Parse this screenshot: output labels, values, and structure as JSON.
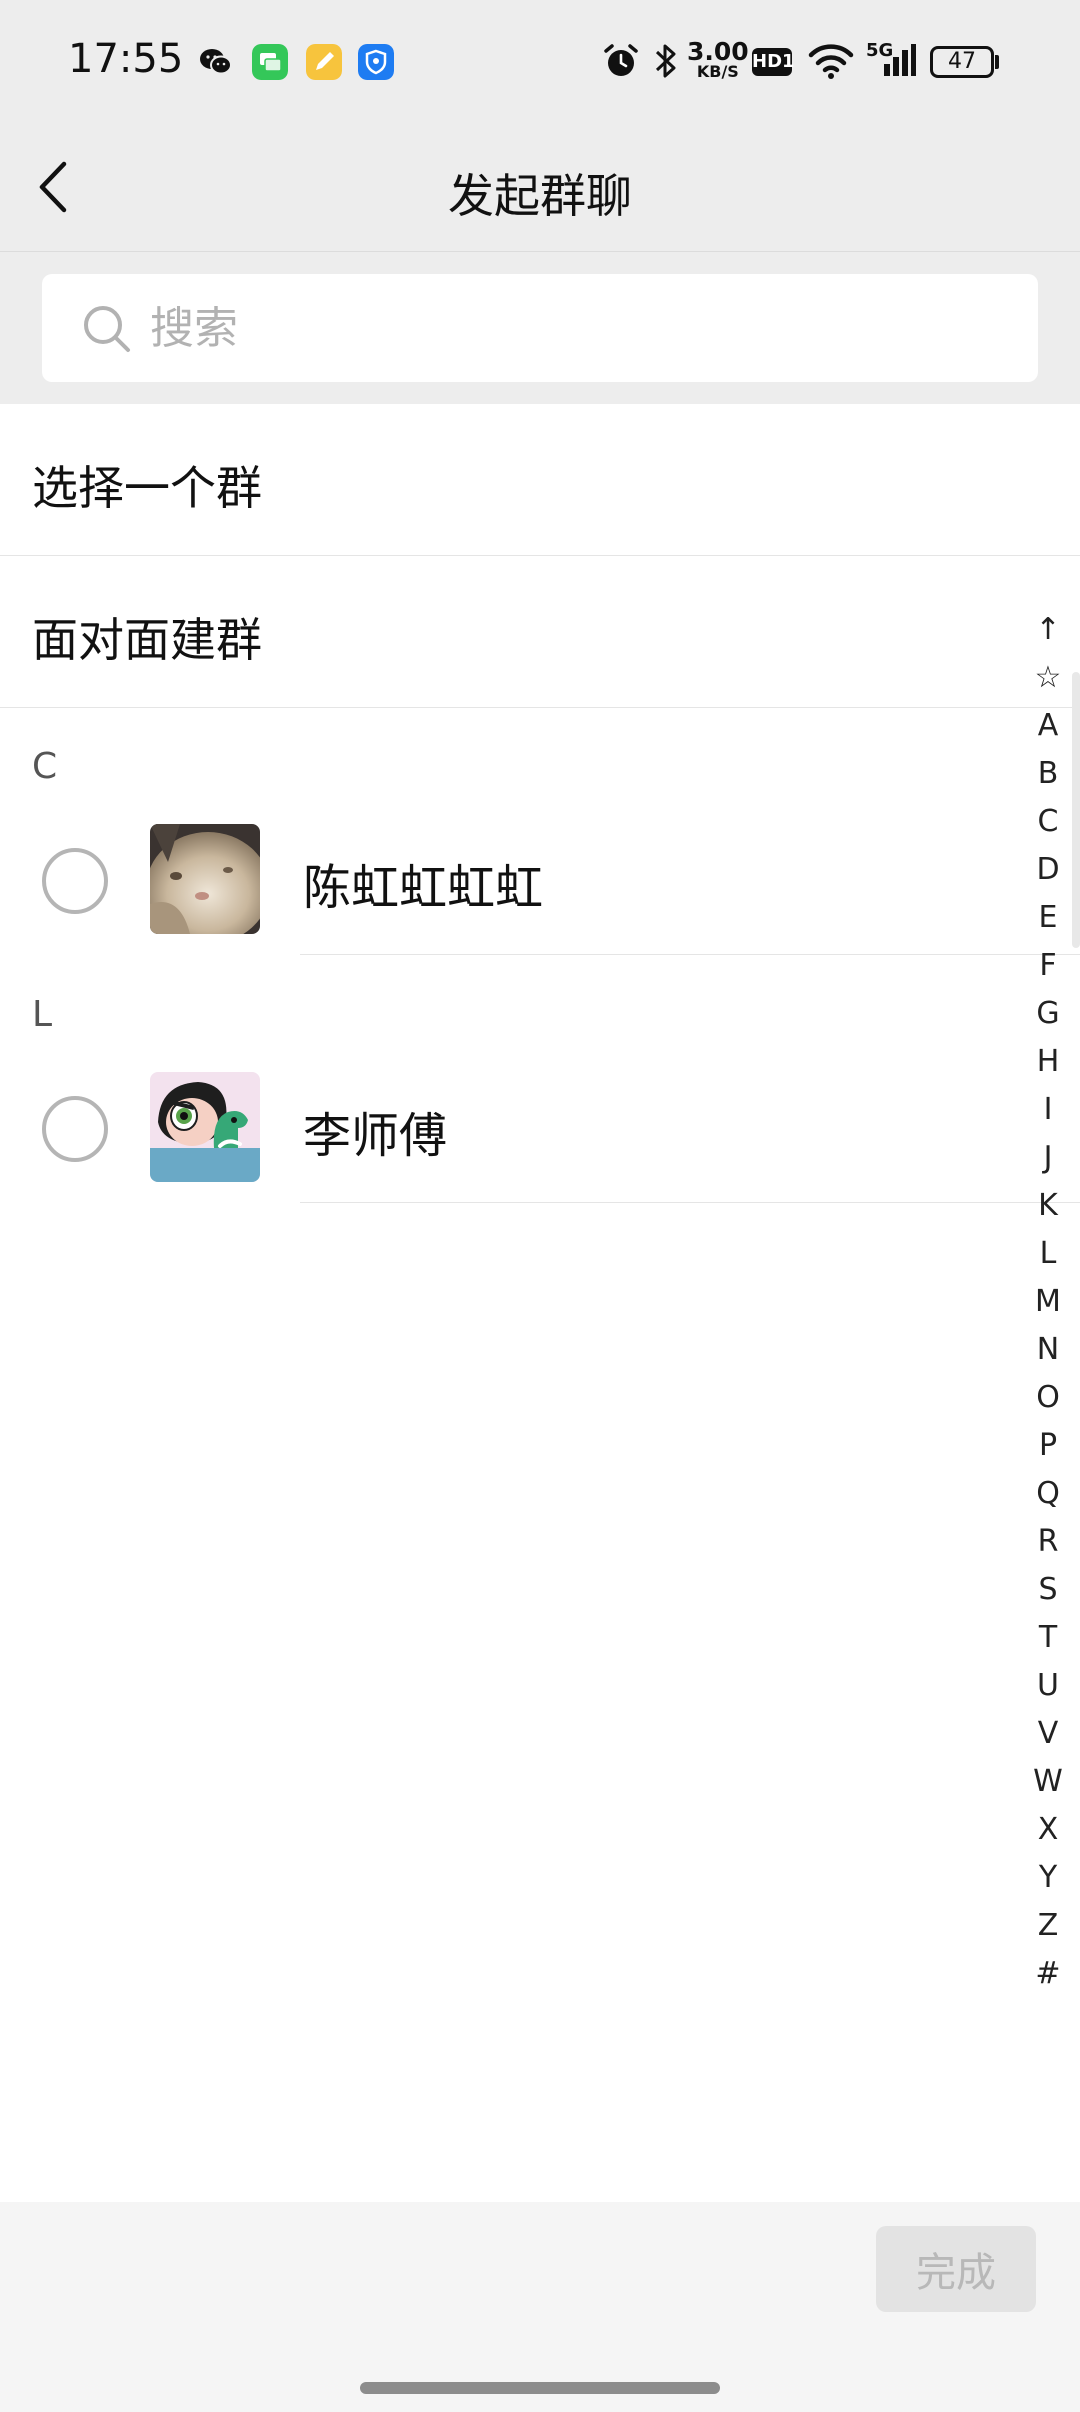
{
  "status_bar": {
    "time": "17:55",
    "apps": [
      {
        "name": "wechat-icon",
        "color": "#111111"
      },
      {
        "name": "messages-icon",
        "color": "#34c759"
      },
      {
        "name": "notes-icon",
        "color": "#f7c43d"
      },
      {
        "name": "security-icon",
        "color": "#1e7cf2"
      }
    ],
    "net_speed_value": "3.00",
    "net_speed_unit": "KB/S",
    "hd_label": "HD1",
    "signal_label": "5G",
    "battery": "47"
  },
  "nav": {
    "title": "发起群聊"
  },
  "search": {
    "placeholder": "搜索"
  },
  "menu": {
    "select_group": "选择一个群",
    "face_to_face": "面对面建群"
  },
  "sections": [
    {
      "letter": "C",
      "contacts": [
        {
          "name": "陈虹虹虹虹",
          "selected": false
        }
      ]
    },
    {
      "letter": "L",
      "contacts": [
        {
          "name": "李师傅",
          "selected": false
        }
      ]
    }
  ],
  "index_bar": [
    "↑",
    "☆",
    "A",
    "B",
    "C",
    "D",
    "E",
    "F",
    "G",
    "H",
    "I",
    "J",
    "K",
    "L",
    "M",
    "N",
    "O",
    "P",
    "Q",
    "R",
    "S",
    "T",
    "U",
    "V",
    "W",
    "X",
    "Y",
    "Z",
    "#"
  ],
  "bottom": {
    "done_label": "完成"
  },
  "colors": {
    "header_bg": "#ededed",
    "done_disabled_bg": "#e3e3e3",
    "done_disabled_text": "#b8b8b8"
  }
}
